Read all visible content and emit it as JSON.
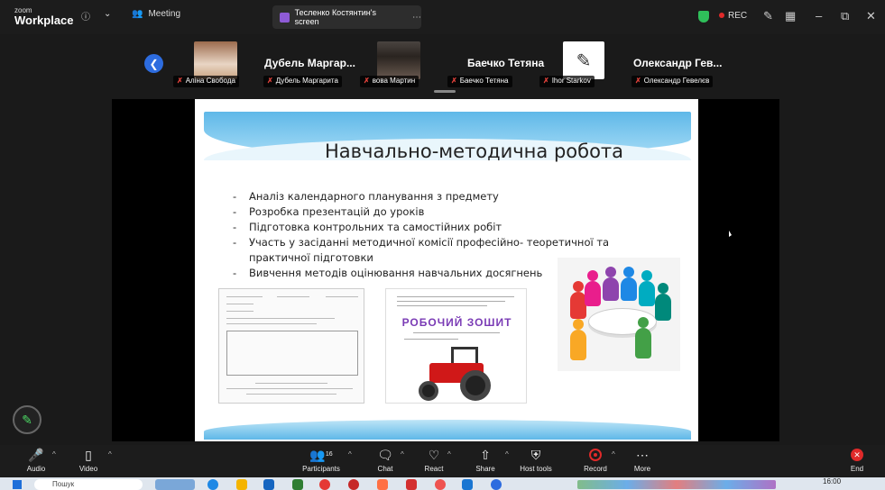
{
  "titlebar": {
    "logo_top": "zoom",
    "logo_bottom": "Workplace",
    "meeting_label": "Meeting",
    "share_tab": "Тесленко Костянтин's screen",
    "rec": "REC"
  },
  "gallery": {
    "participants": [
      {
        "label": "Аліна Свобода"
      },
      {
        "name": "Дубель Маргар...",
        "label": "Дубель Маргарита"
      },
      {
        "label": "вова Мартин"
      },
      {
        "name": "Баечко Тетяна",
        "label": "Баечко Тетяна"
      },
      {
        "label": "Ihor Starkov"
      },
      {
        "name": "Олександр Гев...",
        "label": "Олександр Гевелєв"
      }
    ]
  },
  "slide": {
    "title": "Навчально-методична робота",
    "bullets": [
      "Аналіз календарного планування з предмету",
      "Розробка презентацій до уроків",
      "Підготовка контрольних та самостійних робіт",
      "Участь у засіданні методичної комісії професійно- теоретичної та практичної підготовки",
      "Вивчення методів  оцінювання навчальних досягнень"
    ],
    "workbook_title": "РОБОЧИЙ ЗОШИТ"
  },
  "toolbar": {
    "audio": "Audio",
    "video": "Video",
    "participants": "Participants",
    "participants_count": "16",
    "chat": "Chat",
    "react": "React",
    "share": "Share",
    "host_tools": "Host tools",
    "record": "Record",
    "more": "More",
    "end": "End"
  },
  "taskbar": {
    "search": "Пошук",
    "time": "16:00"
  },
  "colors": {
    "accent_blue": "#2d6cdf",
    "rec_red": "#e02a2a",
    "shield_green": "#2fbf5a"
  }
}
